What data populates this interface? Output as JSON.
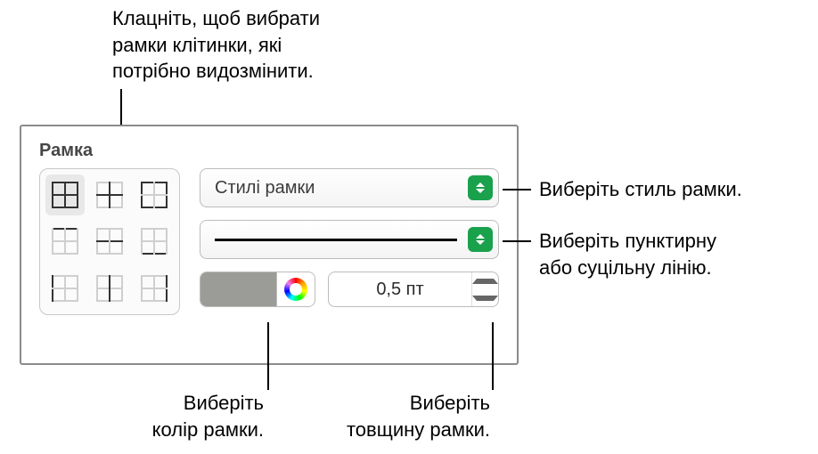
{
  "callouts": {
    "top": "Клацніть, щоб вибрати\nрамки клітинки, які\nпотрібно видозмінити.",
    "right1": "Виберіть стиль рамки.",
    "right2": "Виберіть пунктирну\nабо суцільну лінію.",
    "bottom_left": "Виберіть\nколір рамки.",
    "bottom_right": "Виберіть\nтовщину рамки."
  },
  "panel": {
    "title": "Рамка",
    "border_style_label": "Стилі рамки",
    "thickness_value": "0,5 пт"
  },
  "colors": {
    "accent": "#1aa14b",
    "swatch": "#9b9b98"
  }
}
